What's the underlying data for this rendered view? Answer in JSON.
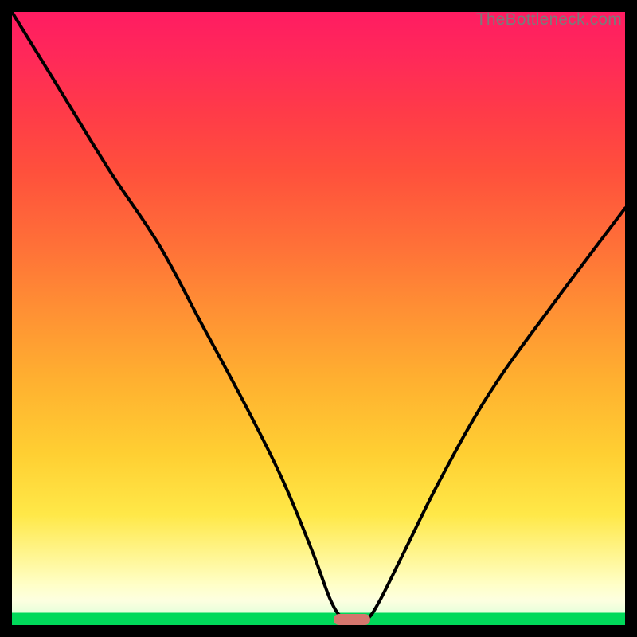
{
  "attribution": "TheBottleneck.com",
  "colors": {
    "frame": "#000000",
    "gradient_top": "#ff1c62",
    "gradient_mid": "#ffe848",
    "gradient_bottom": "#00d95a",
    "curve": "#000000",
    "marker": "#d5766e"
  },
  "chart_data": {
    "type": "line",
    "title": "",
    "xlabel": "",
    "ylabel": "",
    "xlim": [
      0,
      100
    ],
    "ylim": [
      0,
      100
    ],
    "legend": false,
    "grid": false,
    "annotations": [
      {
        "text": "TheBottleneck.com",
        "position": "top-right"
      }
    ],
    "series": [
      {
        "name": "bottleneck-curve",
        "comment": "V-shaped black curve; minimum sits slightly right of center on the baseline. Values estimated from pixels: y≈0 at x≈53–58, rising steeply on both sides.",
        "x": [
          0,
          8,
          16,
          24,
          31,
          38,
          44,
          49,
          52,
          54,
          56,
          58,
          60,
          64,
          70,
          78,
          88,
          100
        ],
        "values": [
          100,
          87,
          74,
          62,
          49,
          36,
          24,
          12,
          4,
          1,
          0,
          1,
          4,
          12,
          24,
          38,
          52,
          68
        ]
      }
    ],
    "marker": {
      "comment": "Small rounded pink bar at the curve minimum on the baseline",
      "x_center_percent": 55.5,
      "y_percent": 0,
      "width_percent": 6,
      "height_percent": 1.8
    },
    "background": {
      "type": "vertical-gradient",
      "stops": [
        {
          "pct": 0,
          "color": "#00d95a"
        },
        {
          "pct": 2,
          "color": "#e6ffda"
        },
        {
          "pct": 10,
          "color": "#fff8a0"
        },
        {
          "pct": 28,
          "color": "#ffcf32"
        },
        {
          "pct": 52,
          "color": "#ff8e34"
        },
        {
          "pct": 74,
          "color": "#ff503c"
        },
        {
          "pct": 100,
          "color": "#ff1c62"
        }
      ]
    }
  }
}
